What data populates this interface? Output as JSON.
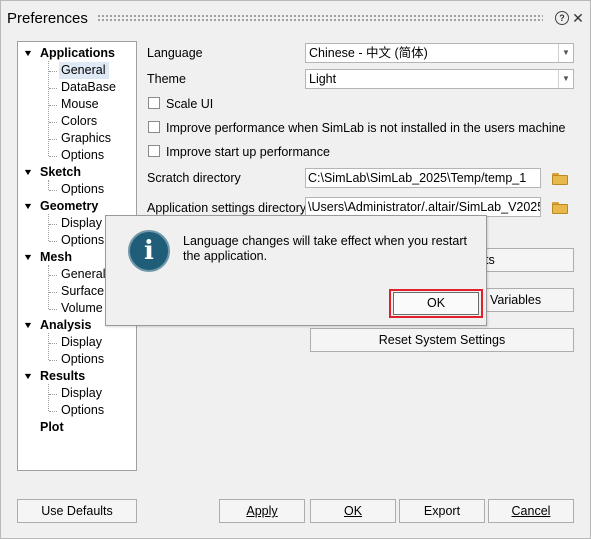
{
  "window": {
    "title": "Preferences",
    "help_icon": "help-icon",
    "close_icon": "close-icon",
    "close_glyph": "✕",
    "help_glyph": "?"
  },
  "tree": [
    {
      "label": "Applications",
      "parent": true
    },
    {
      "label": "General",
      "parent": false,
      "selected": true
    },
    {
      "label": "DataBase",
      "parent": false
    },
    {
      "label": "Mouse",
      "parent": false
    },
    {
      "label": "Colors",
      "parent": false
    },
    {
      "label": "Graphics",
      "parent": false
    },
    {
      "label": "Options",
      "parent": false
    },
    {
      "label": "Sketch",
      "parent": true
    },
    {
      "label": "Options",
      "parent": false
    },
    {
      "label": "Geometry",
      "parent": true
    },
    {
      "label": "Display",
      "parent": false
    },
    {
      "label": "Options",
      "parent": false
    },
    {
      "label": "Mesh",
      "parent": true
    },
    {
      "label": "General",
      "parent": false
    },
    {
      "label": "Surface",
      "parent": false
    },
    {
      "label": "Volume",
      "parent": false
    },
    {
      "label": "Analysis",
      "parent": true
    },
    {
      "label": "Display",
      "parent": false
    },
    {
      "label": "Options",
      "parent": false
    },
    {
      "label": "Results",
      "parent": true
    },
    {
      "label": "Display",
      "parent": false
    },
    {
      "label": "Options",
      "parent": false
    },
    {
      "label": "Plot",
      "parent": true,
      "leaf": true
    }
  ],
  "settings": {
    "language_label": "Language",
    "language_value": "Chinese - 中文 (简体)",
    "theme_label": "Theme",
    "theme_value": "Light",
    "scale_ui": "Scale UI",
    "improve_perf": "Improve performance when SimLab is not installed in the users machine",
    "improve_startup": "Improve start up performance",
    "scratch_label": "Scratch directory",
    "scratch_value": "C:\\SimLab\\SimLab_2025\\Temp/temp_1",
    "appsettings_label": "Application settings directory",
    "appsettings_value": "\\Users\\Administrator/.altair/SimLab_V2025",
    "btn_shortcuts_tail": "ts",
    "btn_env_tail": "t Variables",
    "btn_reset": "Reset System Settings"
  },
  "dialog": {
    "message": "Language changes will take effect when you restart the application.",
    "icon": "info-icon",
    "ok": "OK"
  },
  "footer": {
    "use_defaults": "Use Defaults",
    "apply": "Apply",
    "ok": "OK",
    "export": "Export",
    "cancel": "Cancel"
  },
  "colors": {
    "highlight_border": "#e0202a",
    "info_icon": "#1f5d78",
    "selection": "#dfe9f5"
  }
}
